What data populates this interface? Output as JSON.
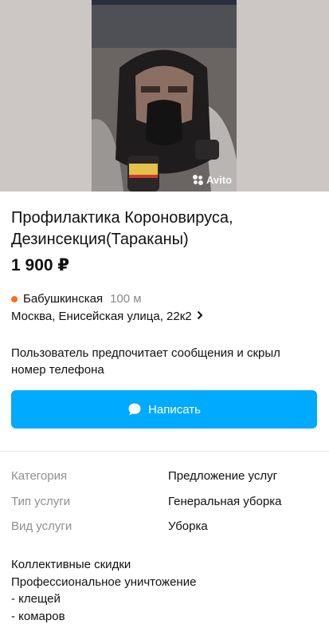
{
  "photo": {
    "watermark": "Avito"
  },
  "listing": {
    "title": "Профилактика Короновируса, Дезинсекция(Тараканы)",
    "price": "1 900 ₽"
  },
  "location": {
    "metro": "Бабушкинская",
    "metro_color": "#ff6b1a",
    "distance": "100 м",
    "address": "Москва, Енисейская улица, 22к2"
  },
  "contact": {
    "notice": "Пользователь предпочитает сообщения и скрыл номер телефона",
    "write_button": "Написать",
    "button_color": "#00aaff"
  },
  "params": [
    {
      "label": "Категория",
      "value": "Предложение услуг"
    },
    {
      "label": "Тип услуги",
      "value": "Генеральная уборка"
    },
    {
      "label": "Вид услуги",
      "value": "Уборка"
    }
  ],
  "description": [
    "Коллективные скидки",
    "Профессиональное уничтожение",
    "- клещей",
    "- комаров"
  ]
}
